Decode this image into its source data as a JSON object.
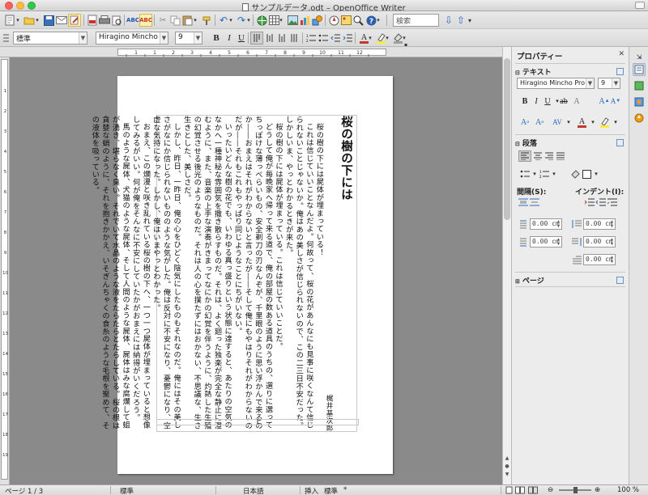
{
  "window": {
    "title": "サンプルデータ.odt – OpenOffice Writer"
  },
  "toolbar_standard": {
    "search_placeholder": "検索",
    "icons": [
      "new-icon",
      "open-icon",
      "save-icon",
      "mail-icon",
      "edit-doc-icon",
      "pdf-icon",
      "print-icon",
      "print-preview-icon",
      "spellcheck-icon",
      "autospell-icon",
      "cut-icon",
      "copy-icon",
      "paste-icon",
      "clone-format-icon",
      "undo-icon",
      "redo-icon",
      "hyperlink-icon",
      "table-icon",
      "image-icon",
      "chart-icon",
      "draw-icon",
      "navigator-icon",
      "gallery-icon",
      "zoom-icon",
      "help-icon"
    ]
  },
  "toolbar_format": {
    "paragraph_style": "標準",
    "font_name": "Hiragino Mincho Pro",
    "font_size": "9",
    "bold": "B",
    "italic": "I",
    "underline": "U"
  },
  "ruler": {
    "h_labels": [
      "1",
      "1",
      "2",
      "3",
      "4",
      "5",
      "6",
      "7",
      "8",
      "9",
      "10",
      "11",
      "12"
    ],
    "v_labels": [
      "1",
      "2",
      "3",
      "4",
      "5",
      "6",
      "7",
      "8",
      "9",
      "10",
      "11",
      "12",
      "13",
      "14",
      "15",
      "16",
      "17",
      "18",
      "19"
    ]
  },
  "document": {
    "title": "桜の樹の下には",
    "author": "梶井基次郎",
    "columns": [
      "桜の樹の下には屍体が埋まっている！",
      "これは信じていいことなんだよ。何故って、桜の花があんなにも見事に咲くなんて信じられないことじゃないか。俺はあの美しさが信じられないので、この二三日不安だった。しかしいま、やっとわかるときが来た。",
      "桜の樹の下には屍体が埋まっている。これは信じていいことだ。",
      "どうして俺が毎晩家へ帰って来る道で、俺の部屋の数ある道具のうちの、選りに選ってちっぽけな薄っぺらいもの、安全剃刀の刃なんぞが、千里眼のように思い浮かんで来るのか――おまえはそれがわからないと言ったが――そして俺にもやはりそれがわからないのだが――それもこれもやっぱり同じようなことにちがいない。",
      "いったいどんな樹の花でも、いわゆる真っ盛りという状態に達すると、あたりの空気のなかへ一種神秘な雰囲気を撒き散らすものだ。それは、よく廻った独楽が完全な静止に澄むように、また、音楽の上手な演奏がきまってなにかの幻覚を伴うように、灼熱した生殖の幻覚させる後光のようなものだ。それは人の心を撲たずにはおかない、不思議な、生き生きとした、美しさだ。",
      "しかし、昨日、一昨日、俺の心をひどく陰気にしたものもそれなのだ。俺にはその美しさがなにか信じられないもののような気がした。俺は反対に不安になり、憂鬱になり、空虚な気持になった。しかし、俺はいまやっとわかった。",
      "おまえ、この爛漫と咲き乱れている桜の樹の下へ、一つ一つ屍体が埋まっていると想像してみるがいい。何が俺をそんなに不安にしていたかがおまえには納得がいくだろう。",
      "馬のような屍体、犬猫のような屍体、そして人間のような屍体、屍体はみな腐爛して蛆が湧き、堪らなく臭い。それでいて水晶のような液をたらたらとたらしている。桜の根は貪婪な蛸のように、それを抱きかかえ、いそぎんちゃくの食糸のような毛根を聚めて、その液体を吸っている。"
    ],
    "footer_mark": "‖"
  },
  "sidebar": {
    "deck_title": "プロパティー",
    "text_section": "テキスト",
    "font_name": "Hiragino Mincho Pro",
    "font_size": "9",
    "paragraph_section": "段落",
    "spacing_label": "間隔(S):",
    "indent_label": "インデント(I):",
    "spacing_above": "0.00 cm",
    "spacing_below": "0.00 cm",
    "line_spacing": "0.00 cm",
    "indent_before": "0.00 cm",
    "indent_after": "0.00 cm",
    "indent_first": "0.00 cm",
    "page_section": "ページ"
  },
  "statusbar": {
    "page": "ページ 1 / 3",
    "style": "標準",
    "language": "日本語",
    "insert_mode": "挿入",
    "selection_mode": "標準",
    "modified": "*",
    "zoom": "100 %"
  }
}
